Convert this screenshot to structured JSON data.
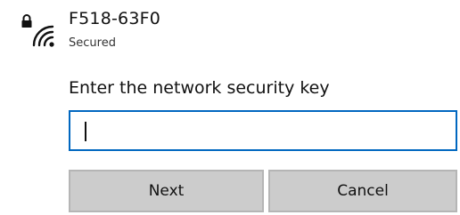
{
  "network": {
    "name": "F518-63F0",
    "status": "Secured",
    "icon": "secured-wifi-icon"
  },
  "prompt": {
    "text": "Enter the network security key"
  },
  "key_input": {
    "value": "",
    "placeholder": ""
  },
  "buttons": {
    "next_label": "Next",
    "cancel_label": "Cancel"
  },
  "colors": {
    "focus_border": "#0067c0",
    "button_bg": "#cccccc"
  }
}
